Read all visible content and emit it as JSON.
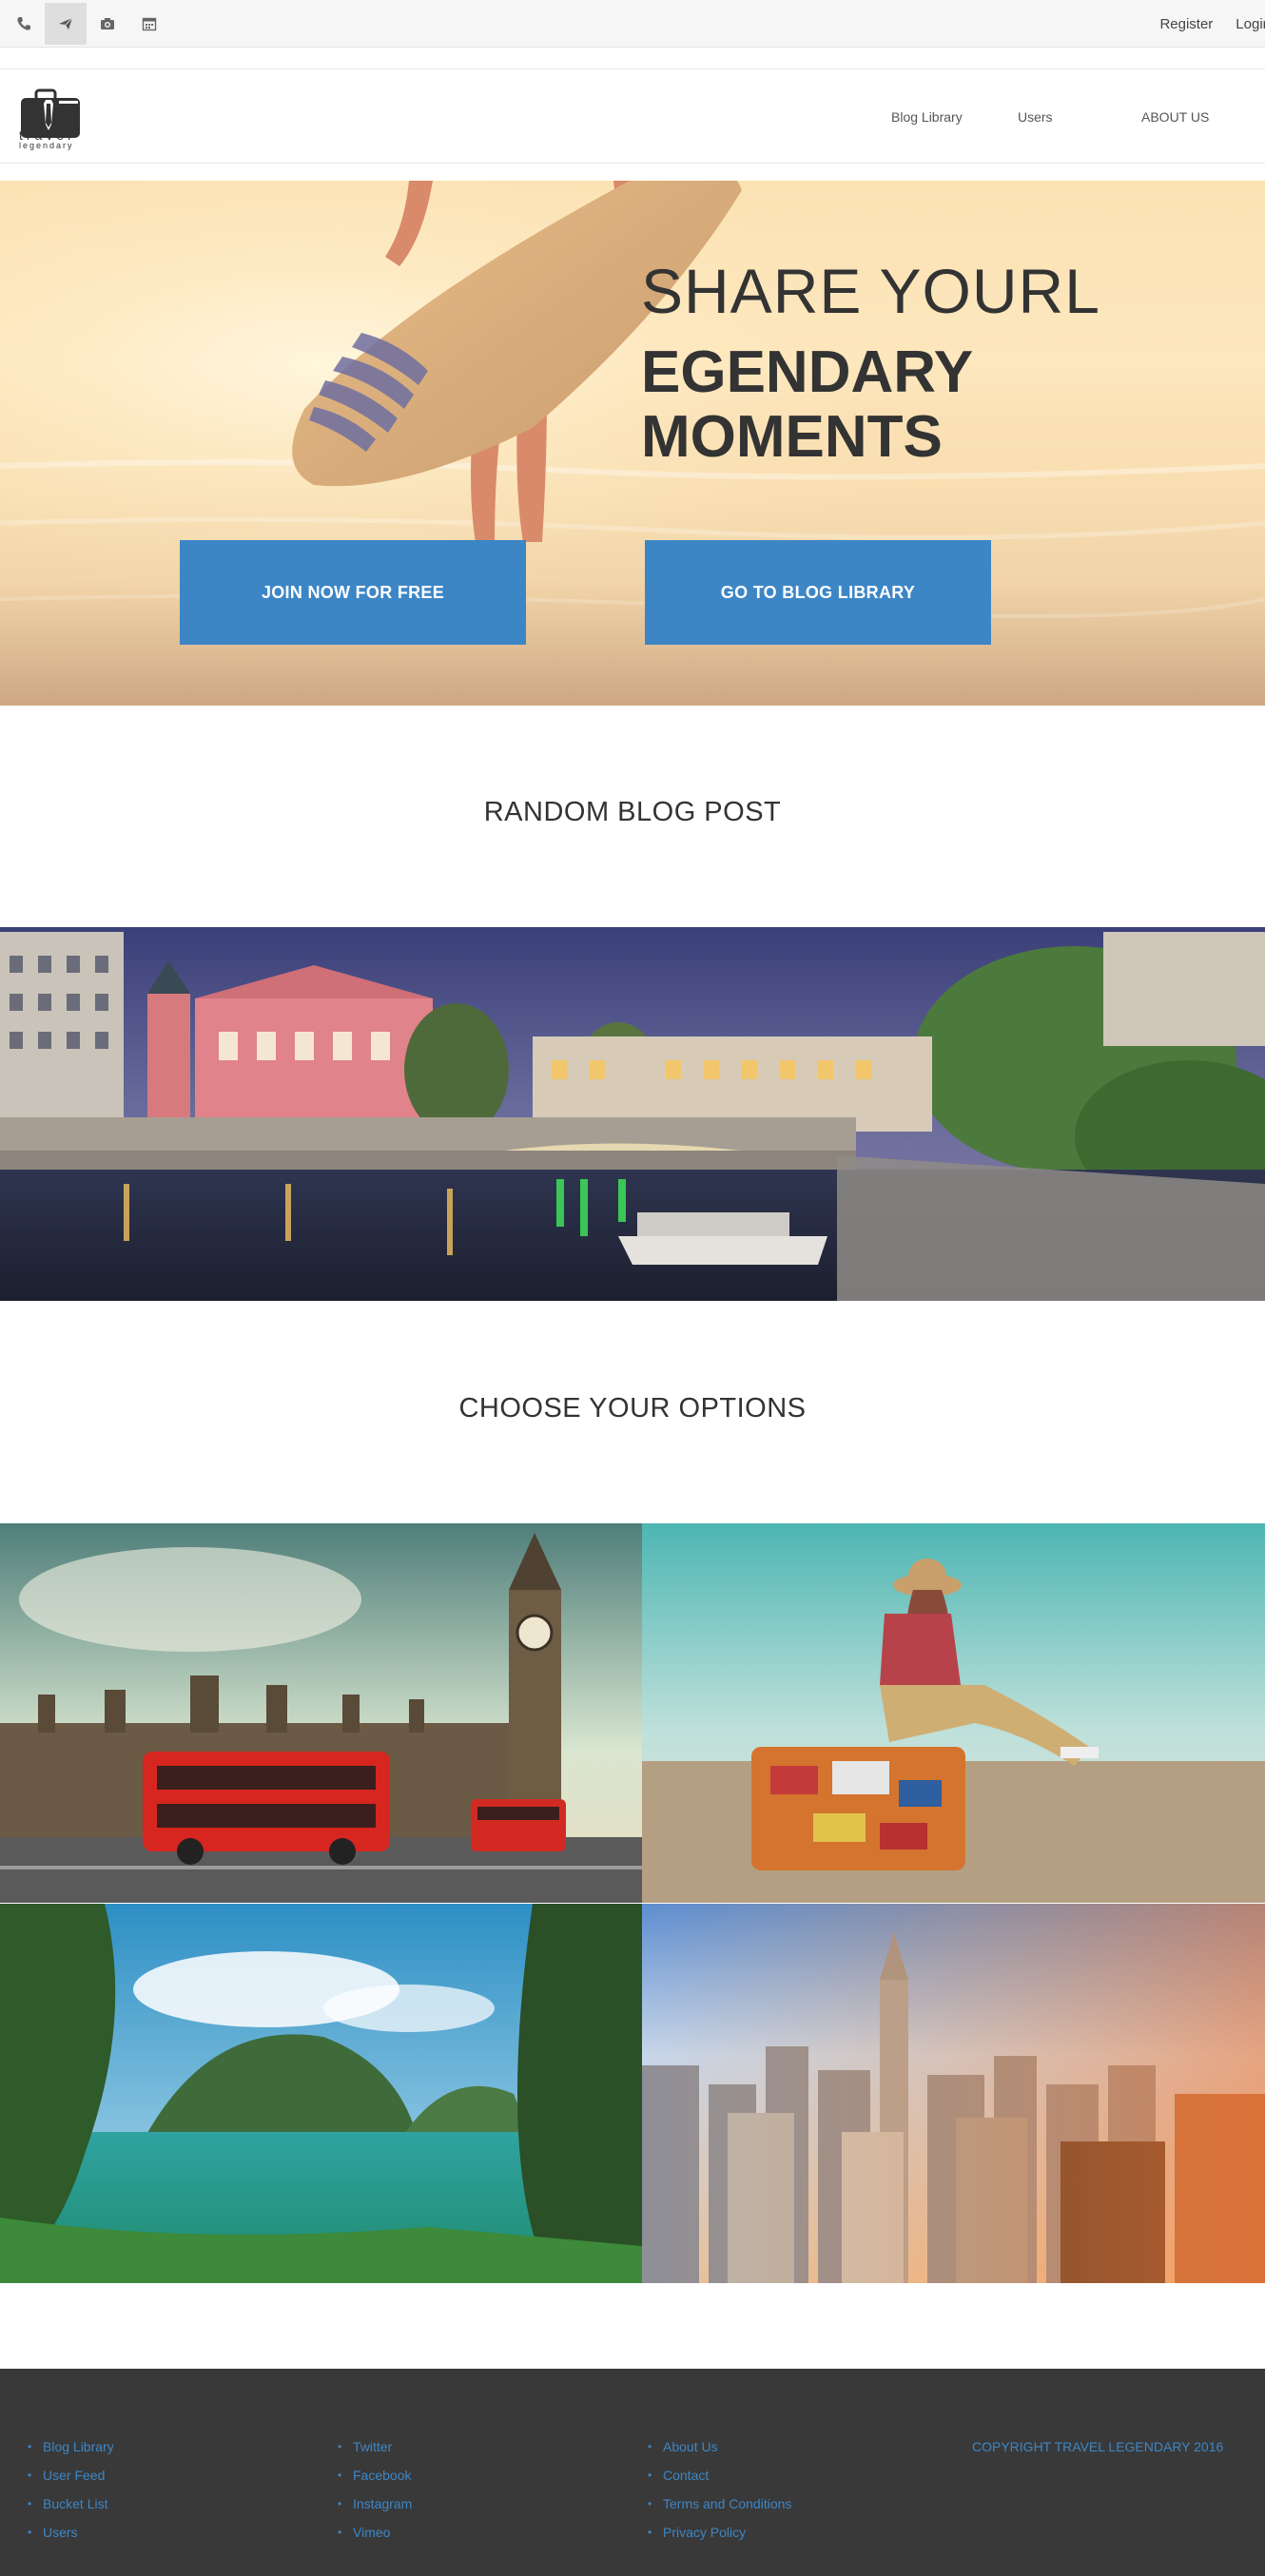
{
  "topbar": {
    "icons": [
      "phone-icon",
      "send-icon",
      "camera-icon",
      "calendar-icon"
    ],
    "register_label": "Register",
    "login_label": "Login"
  },
  "logo": {
    "line1": "travel",
    "line2": "legendary"
  },
  "nav": {
    "items": [
      {
        "label": "Blog Library"
      },
      {
        "label": "Users"
      },
      {
        "label": "ABOUT US"
      }
    ]
  },
  "hero": {
    "title_line1": "SHARE YOURL",
    "title_line2": "EGENDARY MOMENTS",
    "join_label": "JOIN NOW FOR FREE",
    "blog_label": "GO TO BLOG LIBRARY"
  },
  "sections": {
    "random_title": "RANDOM BLOG POST",
    "options_title": "CHOOSE YOUR OPTIONS"
  },
  "footer": {
    "col1": [
      "Blog Library",
      "User Feed",
      "Bucket List",
      "Users"
    ],
    "col2": [
      "Twitter",
      "Facebook",
      "Instagram",
      "Vimeo"
    ],
    "col3": [
      "About Us",
      "Contact",
      "Terms and Conditions",
      "Privacy Policy"
    ],
    "copyright": "COPYRIGHT TRAVEL LEGENDARY 2016"
  },
  "colors": {
    "accent": "#3d86c6",
    "footer_bg": "#393939",
    "topbar_bg": "#f6f6f6"
  }
}
